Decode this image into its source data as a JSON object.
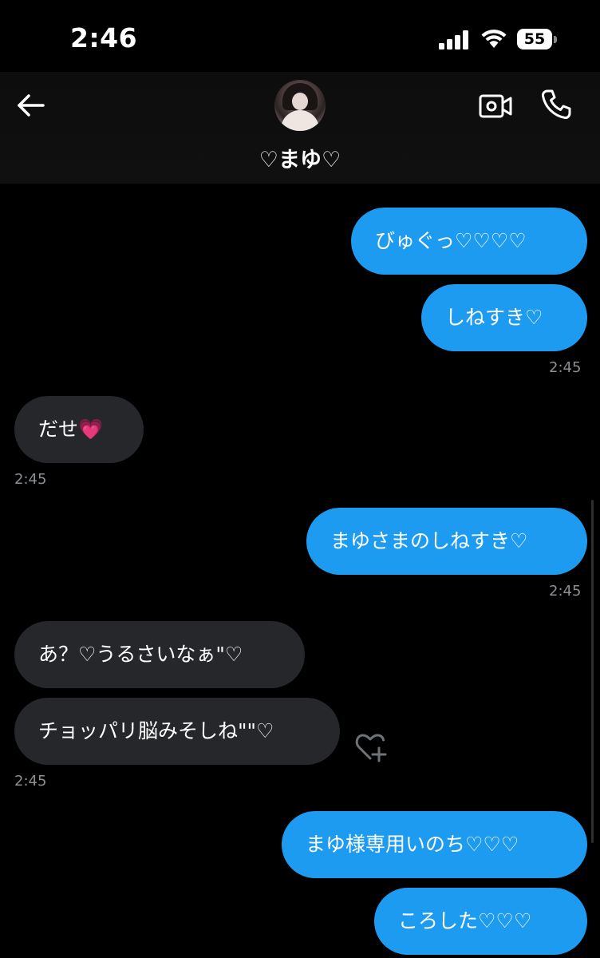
{
  "status_bar": {
    "time": "2:46",
    "battery": "55"
  },
  "header": {
    "contact_name": "♡まゆ♡"
  },
  "messages": [
    {
      "direction": "out",
      "text": "びゅぐっ♡♡♡♡"
    },
    {
      "direction": "out",
      "text": "しねすき♡",
      "time": "2:45"
    },
    {
      "direction": "in",
      "text": "だせ💗",
      "time": "2:45"
    },
    {
      "direction": "out",
      "text": "まゆさまのしねすき♡",
      "time": "2:45"
    },
    {
      "direction": "in",
      "text": "あ？♡うるさいなぁ\"♡"
    },
    {
      "direction": "in",
      "text": "チョッパリ脳みそしね\"\"♡",
      "time": "2:45"
    },
    {
      "direction": "out",
      "text": "まゆ様専用いのち♡♡♡"
    },
    {
      "direction": "out",
      "text": "ころした♡♡♡"
    }
  ],
  "colors": {
    "outgoing_bubble": "#1d9bf0",
    "incoming_bubble": "#25272b",
    "background": "#000000",
    "timestamp": "#8b8f94"
  },
  "icons": {
    "back": "arrow-left-icon",
    "video": "video-camera-icon",
    "phone": "phone-icon",
    "react": "heart-plus-icon"
  }
}
